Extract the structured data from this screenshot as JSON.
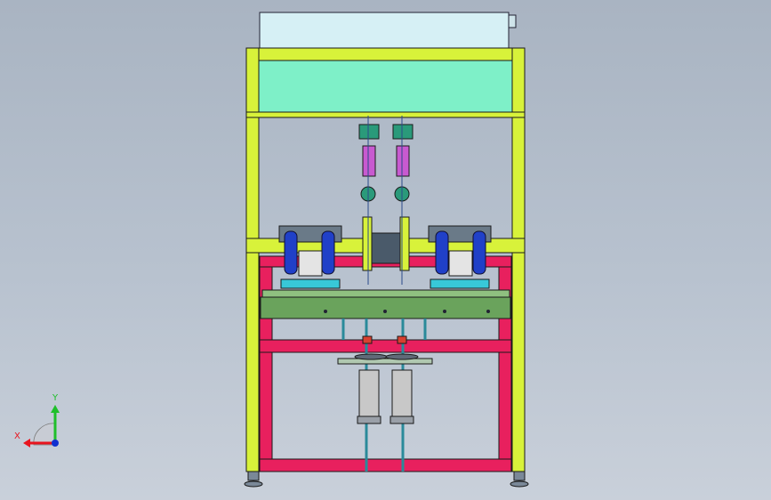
{
  "triad": {
    "x_label": "X",
    "y_label": "Y",
    "x_color": "#e8141e",
    "y_color": "#1fbf2a",
    "z_color": "#1030d0"
  },
  "colors": {
    "background": "#b3bdca",
    "outer_frame": "#d8f23a",
    "inner_frame": "#e8205e",
    "top_panel": "#7ef0c8",
    "top_box": "#d6f0f5",
    "plate": "#6aa35c",
    "cylinder_purple": "#c85ad0",
    "cylinder_green": "#2a9a7a",
    "motor_blue": "#2040c8",
    "cylinder_gray": "#c8c8c8",
    "center_block": "#4a5a6a",
    "base_cyan": "#38c8d8"
  },
  "icons": [
    "coordinate-triad-icon"
  ]
}
